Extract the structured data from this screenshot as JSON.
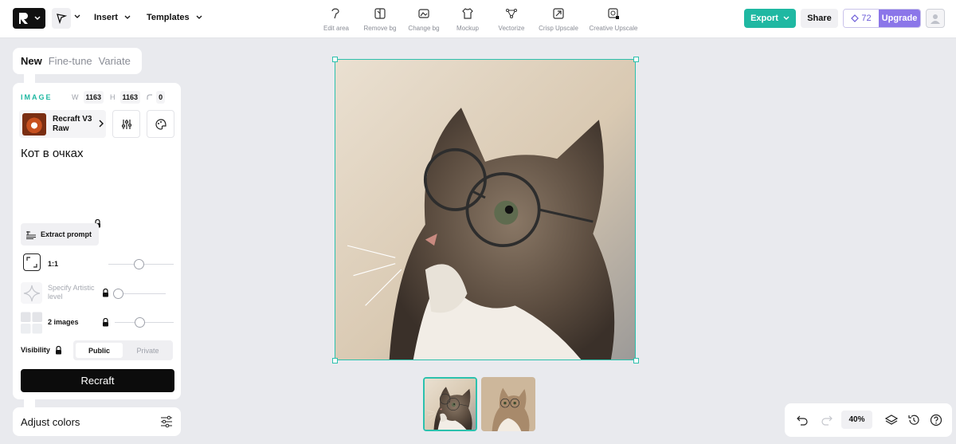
{
  "topbar": {
    "menu_insert": "Insert",
    "menu_templates": "Templates",
    "tools": [
      {
        "label": "Edit area",
        "icon": "edit-area-icon"
      },
      {
        "label": "Remove bg",
        "icon": "remove-bg-icon"
      },
      {
        "label": "Change bg",
        "icon": "change-bg-icon"
      },
      {
        "label": "Mockup",
        "icon": "mockup-icon"
      },
      {
        "label": "Vectorize",
        "icon": "vectorize-icon"
      },
      {
        "label": "Crisp Upscale",
        "icon": "crisp-upscale-icon"
      },
      {
        "label": "Creative Upscale",
        "icon": "creative-upscale-icon"
      }
    ],
    "export_label": "Export",
    "share_label": "Share",
    "credits": "72",
    "upgrade_label": "Upgrade"
  },
  "left_panel": {
    "tabs": [
      "New",
      "Fine-tune",
      "Variate"
    ],
    "active_tab": "New",
    "section_label": "IMAGE",
    "width_key": "W",
    "width": "1163",
    "height_key": "H",
    "height": "1163",
    "radius": "0",
    "model_name": "Recraft V3 Raw",
    "prompt": "Кот в очках",
    "extract_label": "Extract prompt",
    "aspect_label": "1:1",
    "artistic_label": "Specify Artistic level",
    "images_label": "2 images",
    "visibility_label": "Visibility",
    "visibility_public": "Public",
    "visibility_private": "Private",
    "visibility_selected": "Public",
    "generate_label": "Recraft",
    "adjust_label": "Adjust colors"
  },
  "canvas": {
    "image_subject": "cat wearing round glasses",
    "thumbnails_count": 2,
    "selected_thumbnail": 1
  },
  "bottom_bar": {
    "zoom": "40%"
  },
  "colors": {
    "accent": "#1fb8a2",
    "upgrade": "#8b76e9",
    "primary_button": "#0c0c0c"
  }
}
